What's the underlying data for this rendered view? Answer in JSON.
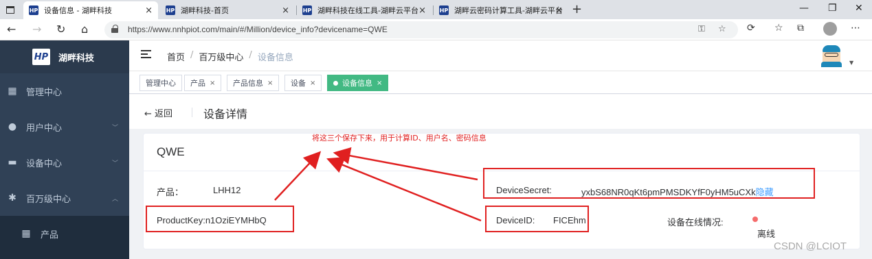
{
  "browser": {
    "tabs": [
      {
        "favicon": "HP",
        "title": "设备信息 - 湖畔科技",
        "close": "×"
      },
      {
        "favicon": "HP",
        "title": "湖畔科技-首页",
        "close": "×"
      },
      {
        "favicon": "HP",
        "title": "湖畔科技在线工具-湖畔云平台",
        "close": "×"
      },
      {
        "favicon": "HP",
        "title": "湖畔云密码计算工具-湖畔云平台",
        "close": "×"
      }
    ],
    "new_tab": "+",
    "window_controls": {
      "minimize": "—",
      "maximize": "❐",
      "close": "✕"
    },
    "url": "https://www.nnhpiot.com/main/#/Million/device_info?devicename=QWE",
    "nav": {
      "back": "←",
      "forward": "→",
      "reload": "↻",
      "home": "⌂"
    },
    "more": "⋯"
  },
  "sidebar": {
    "logo_mark": "HP",
    "logo_text": "湖畔科技",
    "items": [
      {
        "label": "管理中心",
        "icon": "grid-icon",
        "glyph": "■"
      },
      {
        "label": "用户中心",
        "icon": "user-icon",
        "glyph": "●",
        "chevron": "﹀"
      },
      {
        "label": "设备中心",
        "icon": "monitor-icon",
        "glyph": "▬",
        "chevron": "﹀"
      },
      {
        "label": "百万级中心",
        "icon": "gear-icon",
        "glyph": "✱",
        "chevron": "︿"
      },
      {
        "label": "产品",
        "icon": "table-icon",
        "glyph": "▦"
      }
    ]
  },
  "header": {
    "breadcrumb": [
      "首页",
      "百万级中心",
      "设备信息"
    ],
    "breadcrumb_sep": "/"
  },
  "tags": [
    {
      "label": "管理中心",
      "active": false
    },
    {
      "label": "产品",
      "active": false,
      "close": "×"
    },
    {
      "label": "产品信息",
      "active": false,
      "close": "×"
    },
    {
      "label": "设备",
      "active": false,
      "close": "×"
    },
    {
      "label": "设备信息",
      "active": true,
      "close": "×"
    }
  ],
  "main": {
    "back_label": "← 返回",
    "title": "设备详情",
    "device_name": "QWE",
    "product_label": "产品：",
    "product_value": "LHH12",
    "product_key": "ProductKey:n1OziEYMHbQ",
    "device_secret_label": "DeviceSecret:",
    "device_secret_value": "yxbS68NR0qKt6pmPMSDKYfF0yHM5uCXk",
    "hide_link": "隐藏",
    "device_id_label": "DeviceID:",
    "device_id_value": "FICEhm",
    "online_label": "设备在线情况:",
    "online_status": "离线",
    "status_color": "#f56c6c"
  },
  "annotation": {
    "note": "将这三个保存下来，用于计算ID、用户名、密码信息",
    "color": "#e02020"
  },
  "watermark": "CSDN @LCIOT"
}
